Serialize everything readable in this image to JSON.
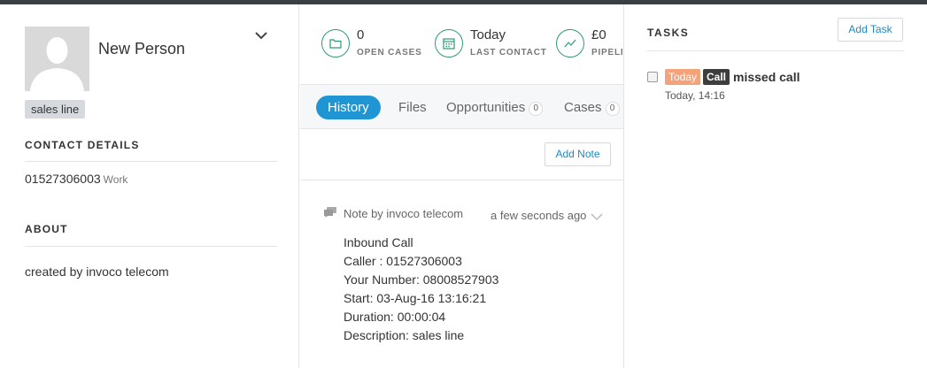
{
  "contact": {
    "name": "New Person",
    "tag": "sales line",
    "contact_details_title": "CONTACT DETAILS",
    "phone": "01527306003",
    "phone_type": "Work",
    "about_title": "ABOUT",
    "about_text": "created by invoco telecom"
  },
  "stats": [
    {
      "value": "0",
      "label": "OPEN CASES",
      "icon": "folder-icon"
    },
    {
      "value": "Today",
      "label": "LAST CONTACT",
      "icon": "calendar-icon"
    },
    {
      "value": "£0",
      "label": "PIPELINE",
      "icon": "chart-line-icon"
    }
  ],
  "tabs": [
    {
      "label": "History",
      "active": true
    },
    {
      "label": "Files"
    },
    {
      "label": "Opportunities",
      "count": "0"
    },
    {
      "label": "Cases",
      "count": "0"
    }
  ],
  "history": {
    "add_note_label": "Add Note",
    "note": {
      "author": "Note by invoco telecom",
      "time": "a few seconds ago",
      "lines": [
        "Inbound Call",
        "Caller : 01527306003",
        "Your Number: 08008527903",
        "Start: 03-Aug-16 13:16:21",
        "Duration: 00:00:04",
        "Description: sales line"
      ]
    }
  },
  "tasks": {
    "title": "TASKS",
    "add_task_label": "Add Task",
    "items": [
      {
        "due_badge": "Today",
        "type_badge": "Call",
        "title": "missed call",
        "time": "Today, 14:16"
      }
    ]
  },
  "colors": {
    "accent": "#1f96d3",
    "stat_icon": "#2e9a72",
    "today_badge": "#f4a27a",
    "call_badge": "#3d3d3d",
    "top_bar": "#3a3f44"
  }
}
